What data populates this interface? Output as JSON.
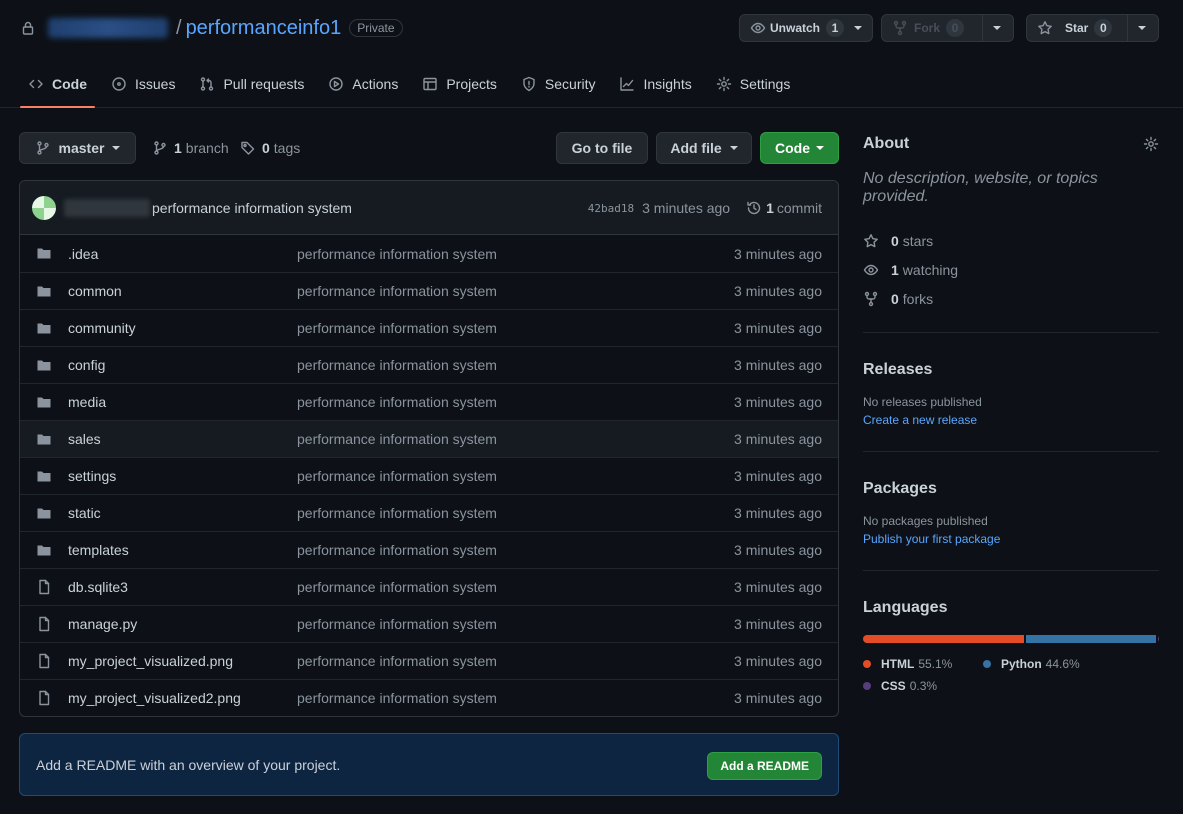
{
  "repo": {
    "name": "performanceinfo1",
    "separator": "/",
    "visibility": "Private"
  },
  "header_buttons": {
    "watch": {
      "label": "Unwatch",
      "count": "1"
    },
    "fork": {
      "label": "Fork",
      "count": "0"
    },
    "star": {
      "label": "Star",
      "count": "0"
    }
  },
  "tabs": [
    {
      "label": "Code",
      "icon": "code-icon",
      "active": true
    },
    {
      "label": "Issues",
      "icon": "issue-icon"
    },
    {
      "label": "Pull requests",
      "icon": "pull-request-icon"
    },
    {
      "label": "Actions",
      "icon": "play-icon"
    },
    {
      "label": "Projects",
      "icon": "table-icon"
    },
    {
      "label": "Security",
      "icon": "shield-icon"
    },
    {
      "label": "Insights",
      "icon": "graph-icon"
    },
    {
      "label": "Settings",
      "icon": "gear-icon"
    }
  ],
  "toolbar": {
    "branch": "master",
    "branches_count": "1",
    "branches_label": "branch",
    "tags_count": "0",
    "tags_label": "tags",
    "go_to_file": "Go to file",
    "add_file": "Add file",
    "code": "Code"
  },
  "commit": {
    "message": "performance information system",
    "sha": "42bad18",
    "time": "3 minutes ago",
    "count": "1",
    "count_label": "commit"
  },
  "files": [
    {
      "name": ".idea",
      "type": "folder",
      "message": "performance information system",
      "age": "3 minutes ago"
    },
    {
      "name": "common",
      "type": "folder",
      "message": "performance information system",
      "age": "3 minutes ago"
    },
    {
      "name": "community",
      "type": "folder",
      "message": "performance information system",
      "age": "3 minutes ago"
    },
    {
      "name": "config",
      "type": "folder",
      "message": "performance information system",
      "age": "3 minutes ago"
    },
    {
      "name": "media",
      "type": "folder",
      "message": "performance information system",
      "age": "3 minutes ago"
    },
    {
      "name": "sales",
      "type": "folder",
      "message": "performance information system",
      "age": "3 minutes ago"
    },
    {
      "name": "settings",
      "type": "folder",
      "message": "performance information system",
      "age": "3 minutes ago"
    },
    {
      "name": "static",
      "type": "folder",
      "message": "performance information system",
      "age": "3 minutes ago"
    },
    {
      "name": "templates",
      "type": "folder",
      "message": "performance information system",
      "age": "3 minutes ago"
    },
    {
      "name": "db.sqlite3",
      "type": "file",
      "message": "performance information system",
      "age": "3 minutes ago"
    },
    {
      "name": "manage.py",
      "type": "file",
      "message": "performance information system",
      "age": "3 minutes ago"
    },
    {
      "name": "my_project_visualized.png",
      "type": "file",
      "message": "performance information system",
      "age": "3 minutes ago"
    },
    {
      "name": "my_project_visualized2.png",
      "type": "file",
      "message": "performance information system",
      "age": "3 minutes ago"
    }
  ],
  "readme": {
    "text": "Add a README with an overview of your project.",
    "button": "Add a README"
  },
  "about": {
    "title": "About",
    "description": "No description, website, or topics provided.",
    "stars": "0",
    "stars_label": "stars",
    "watching": "1",
    "watching_label": "watching",
    "forks": "0",
    "forks_label": "forks"
  },
  "releases": {
    "title": "Releases",
    "text": "No releases published",
    "link": "Create a new release"
  },
  "packages": {
    "title": "Packages",
    "text": "No packages published",
    "link": "Publish your first package"
  },
  "languages": {
    "title": "Languages",
    "items": [
      {
        "name": "HTML",
        "percent": "55.1%",
        "value": 55.1,
        "color": "#e34c26"
      },
      {
        "name": "Python",
        "percent": "44.6%",
        "value": 44.6,
        "color": "#3572a5"
      },
      {
        "name": "CSS",
        "percent": "0.3%",
        "value": 0.3,
        "color": "#563d7c"
      }
    ]
  },
  "colors": {
    "background": "#0d1117",
    "accent_link": "#58a6ff",
    "primary_button": "#238636",
    "active_tab_underline": "#f78166"
  }
}
